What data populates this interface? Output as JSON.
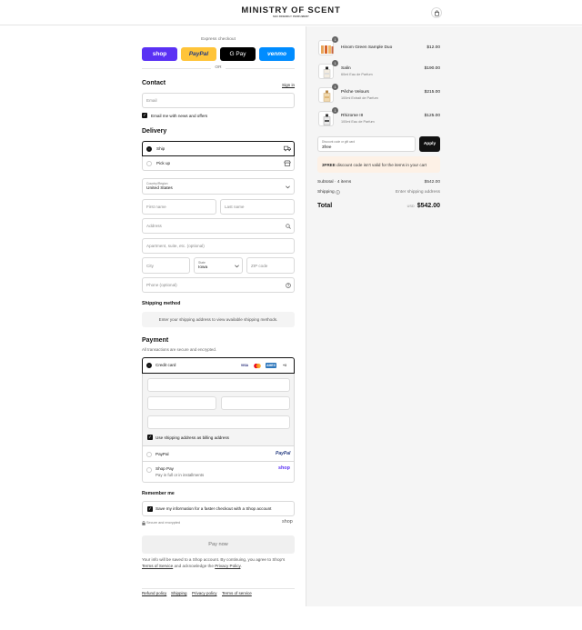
{
  "header": {
    "brand": "MINISTRY OF SCENT",
    "tagline": "SEX FRIENDLY PERFUMERY"
  },
  "express": {
    "label": "Express checkout",
    "buttons": [
      "shop",
      "PayPal",
      "G Pay",
      "venmo"
    ],
    "or": "OR"
  },
  "contact": {
    "title": "Contact",
    "sign_in": "Sign in",
    "email_placeholder": "Email",
    "newsletter_label": "Email me with news and offers"
  },
  "delivery": {
    "title": "Delivery",
    "ship_label": "Ship",
    "pickup_label": "Pick up",
    "country_label": "Country/Region",
    "country_value": "United States",
    "first_name": "First name",
    "last_name": "Last name",
    "address": "Address",
    "apartment": "Apartment, suite, etc. (optional)",
    "city": "City",
    "state_label": "State",
    "state_value": "Iowa",
    "zip": "ZIP code",
    "phone": "Phone (optional)"
  },
  "shipping_method": {
    "title": "Shipping method",
    "message": "Enter your shipping address to view available shipping methods."
  },
  "payment": {
    "title": "Payment",
    "subtitle": "All transactions are secure and encrypted.",
    "credit_card_label": "Credit card",
    "card_logos": [
      "VISA",
      "MC",
      "AMEX",
      "+3"
    ],
    "billing_same": "Use shipping address as billing address",
    "paypal_label": "PayPal",
    "paypal_logo": "PayPal",
    "shoppay_label": "Shop Pay",
    "shoppay_sub": "Pay in full or in installments",
    "shoppay_logo": "shop"
  },
  "remember": {
    "title": "Remember me",
    "save_label": "Save my information for a faster checkout with a Shop account",
    "secure": "Secure and encrypted",
    "shop_logo": "shop"
  },
  "pay_now": "Pay now",
  "legal": {
    "text1": "Your info will be saved to a Shop account. By continuing, you agree to Shop's",
    "terms": "Terms of Service",
    "text2": "and acknowledge the",
    "privacy": "Privacy Policy",
    "end": "."
  },
  "footer_links": [
    "Refund policy",
    "Shipping",
    "Privacy policy",
    "Terms of service"
  ],
  "order": {
    "items": [
      {
        "name": "Hinom Green Sample Duo",
        "sub": "",
        "price": "$12.00",
        "qty": "1"
      },
      {
        "name": "Salin",
        "sub": "60ml Eau de Parfum",
        "price": "$190.00",
        "qty": "1"
      },
      {
        "name": "Pêche Velours",
        "sub": "100ml Extrait de Parfum",
        "price": "$215.00",
        "qty": "1"
      },
      {
        "name": "Rhizome III",
        "sub": "100ml Eau de Parfum",
        "price": "$125.00",
        "qty": "1"
      }
    ],
    "discount_label": "Discount code or gift card",
    "discount_value": "3free",
    "apply": "Apply",
    "warning_code": "3FREE",
    "warning_text": "discount code isn't valid for the items in your cart",
    "subtotal_label": "Subtotal · 4 items",
    "subtotal_value": "$542.00",
    "shipping_label": "Shipping",
    "shipping_value": "Enter shipping address",
    "total_label": "Total",
    "currency": "USD",
    "total_value": "$542.00"
  }
}
